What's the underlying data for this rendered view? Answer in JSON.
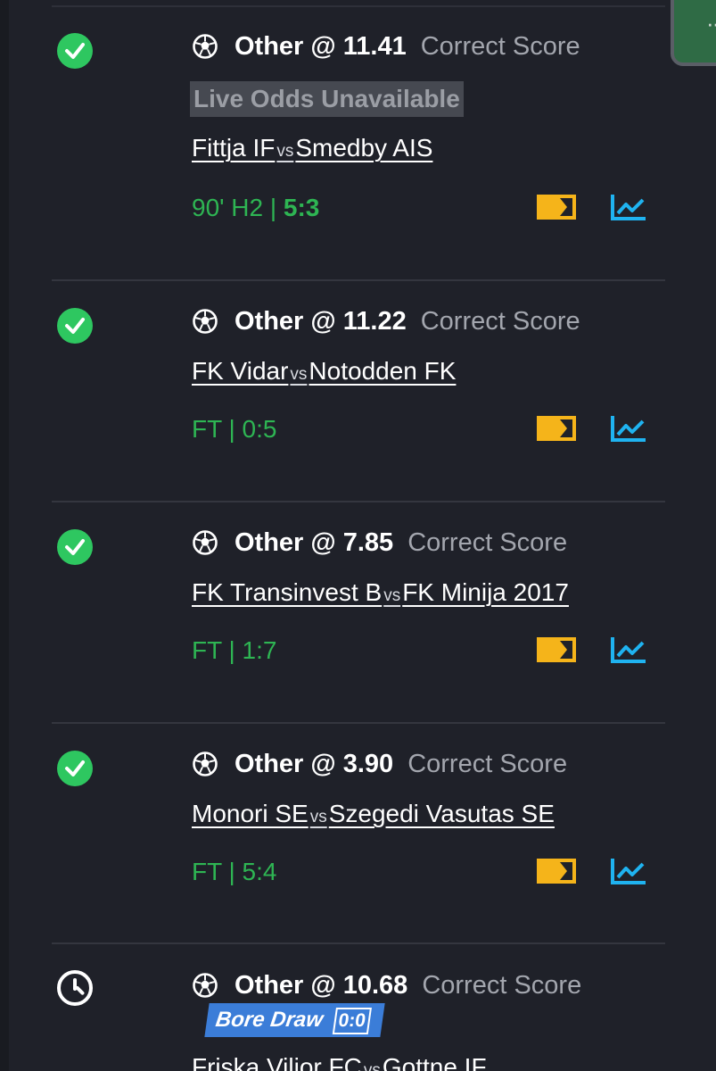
{
  "fab": {
    "icon": "more-dots-icon",
    "color": "#2f6b45"
  },
  "colors": {
    "background": "#1f2129",
    "won": "#2ec760",
    "result": "#2eb553",
    "tv": "#f5b41a",
    "stats": "#1fb3f0",
    "bore_badge": "#3b7dd8"
  },
  "bets": [
    {
      "status": "won",
      "pick": "Other @ 11.41",
      "market": "Correct Score",
      "badge": "Live Odds Unavailable",
      "home": "Fittja IF",
      "vs": "vs",
      "away": "Smedby AIS",
      "result_prefix": "90' H2 | ",
      "result_score": "5:3"
    },
    {
      "status": "won",
      "pick": "Other @ 11.22",
      "market": "Correct Score",
      "home": "FK Vidar",
      "vs": "vs",
      "away": "Notodden FK",
      "result": "FT | 0:5"
    },
    {
      "status": "won",
      "pick": "Other @ 7.85",
      "market": "Correct Score",
      "home": "FK Transinvest B",
      "vs": "vs",
      "away": "FK Minija 2017",
      "result": "FT | 1:7"
    },
    {
      "status": "won",
      "pick": "Other @ 3.90",
      "market": "Correct Score",
      "home": "Monori SE",
      "vs": "vs",
      "away": "Szegedi Vasutas SE",
      "result": "FT | 5:4"
    },
    {
      "status": "pending",
      "pick": "Other @ 10.68",
      "market": "Correct Score",
      "badge_text": "Bore Draw",
      "badge_score": "0:0",
      "home": "Friska Viljor FC",
      "vs": "vs",
      "away": "Gottne IF"
    }
  ]
}
